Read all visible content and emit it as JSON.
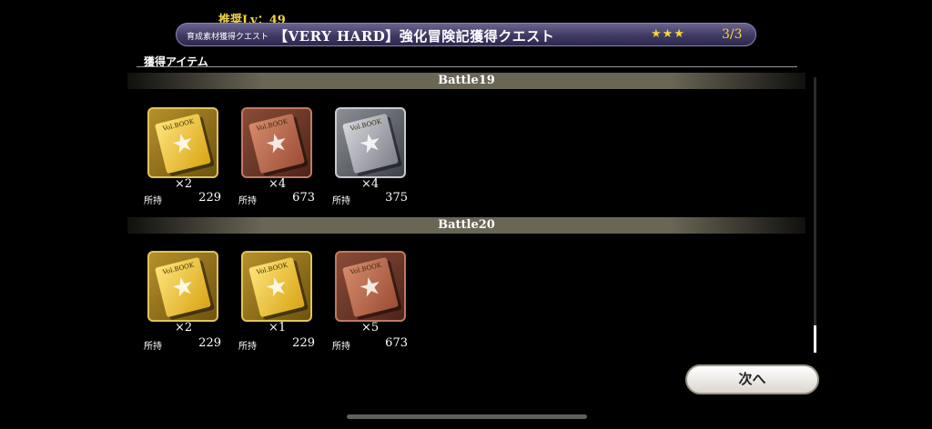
{
  "header": {
    "recommended_level": "推奨Lv：49",
    "quest_subtitle": "育成素材獲得クエスト",
    "quest_title": "【VERY HARD】強化冒険記獲得クエスト",
    "stars": "★★★",
    "count": "3/3",
    "section_label": "獲得アイテム",
    "colors": {
      "accent": "#f7d438",
      "bar": "#3f3a63"
    }
  },
  "battles": [
    {
      "title": "Battle19",
      "items": [
        {
          "tier": "gold",
          "icon": "gold-book-icon",
          "book_text": "Vol.BOOK",
          "qty": "×2",
          "own_label": "所持",
          "own": "229"
        },
        {
          "tier": "bronze",
          "icon": "bronze-book-icon",
          "book_text": "Vol.BOOK",
          "qty": "×4",
          "own_label": "所持",
          "own": "673"
        },
        {
          "tier": "silver",
          "icon": "silver-book-icon",
          "book_text": "Vol.BOOK",
          "qty": "×4",
          "own_label": "所持",
          "own": "375"
        }
      ]
    },
    {
      "title": "Battle20",
      "items": [
        {
          "tier": "gold",
          "icon": "gold-book-icon",
          "book_text": "Vol.BOOK",
          "qty": "×2",
          "own_label": "所持",
          "own": "229"
        },
        {
          "tier": "gold",
          "icon": "gold-book-icon",
          "book_text": "Vol.BOOK",
          "qty": "×1",
          "own_label": "所持",
          "own": "229"
        },
        {
          "tier": "bronze",
          "icon": "bronze-book-icon",
          "book_text": "Vol.BOOK",
          "qty": "×5",
          "own_label": "所持",
          "own": "673"
        }
      ]
    }
  ],
  "footer": {
    "next_label": "次へ"
  }
}
